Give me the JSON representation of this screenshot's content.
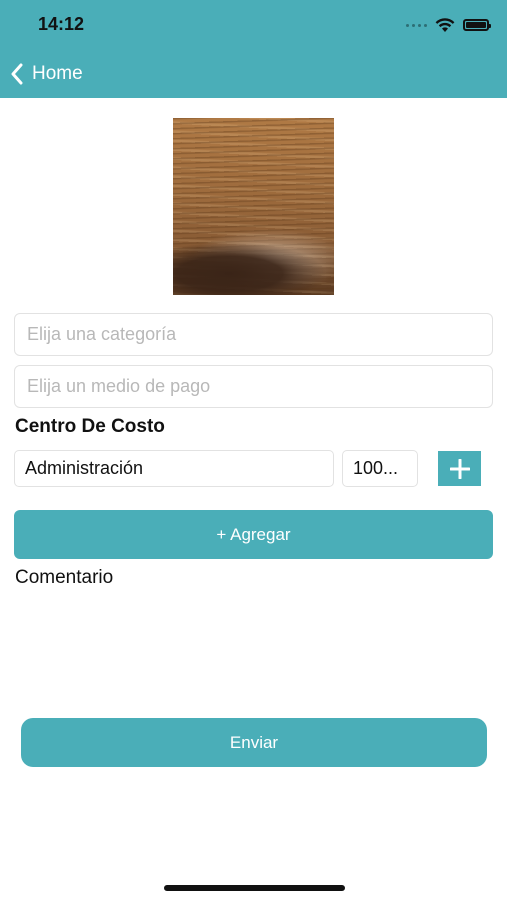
{
  "status_bar": {
    "time": "14:12"
  },
  "nav": {
    "back_label": "Home"
  },
  "form": {
    "category_placeholder": "Elija una categoría",
    "payment_placeholder": "Elija un medio de pago",
    "cost_center_title": "Centro De Costo",
    "cost_center_value": "Administración",
    "percentage_value": "100...",
    "add_button_label": "+ Agregar",
    "comment_label": "Comentario",
    "submit_button_label": "Enviar"
  },
  "colors": {
    "accent": "#4aaeb8",
    "background": "#ffffff",
    "text": "#111111",
    "placeholder": "#b8b8b8"
  },
  "icons": [
    "wifi-icon",
    "battery-icon",
    "chevron-left-icon",
    "plus-icon"
  ]
}
